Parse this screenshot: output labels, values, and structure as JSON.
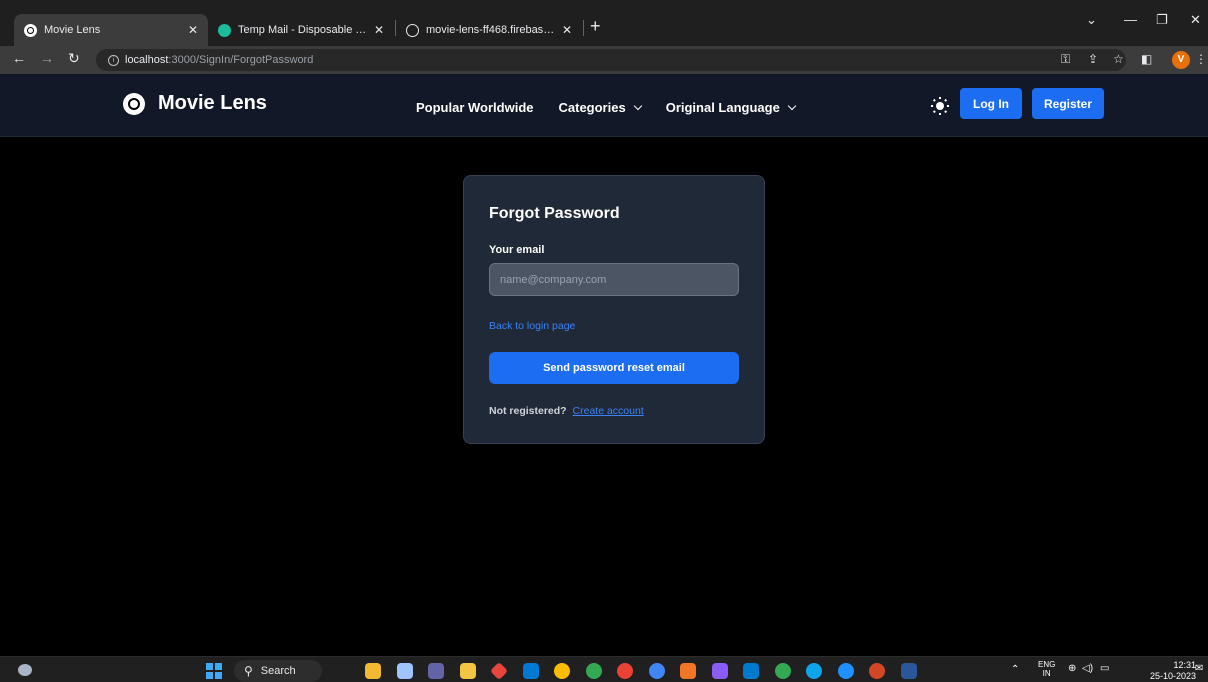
{
  "browser": {
    "tabs": [
      {
        "title": "Movie Lens",
        "favicon": "movielens-favicon"
      },
      {
        "title": "Temp Mail - Disposable Tempor",
        "favicon": "tempmail-favicon"
      },
      {
        "title": "movie-lens-ff468.firebaseapp.co",
        "favicon": "globe-icon"
      }
    ],
    "url_host": "localhost",
    "url_path": ":3000/SignIn/ForgotPassword",
    "profile_initial": "V"
  },
  "navbar": {
    "brand": "Movie Lens",
    "links": [
      "Popular Worldwide",
      "Categories",
      "Original Language"
    ],
    "login_label": "Log In",
    "register_label": "Register"
  },
  "form": {
    "title": "Forgot Password",
    "email_label": "Your email",
    "email_placeholder": "name@company.com",
    "email_value": "",
    "back_link": "Back to login page",
    "submit_label": "Send password reset email",
    "footer_prefix": "Not registered?",
    "footer_link": "Create account"
  },
  "taskbar": {
    "search_label": "Search",
    "language": "ENG",
    "region": "IN",
    "time": "12:31",
    "date": "25-10-2023"
  },
  "colors": {
    "accent": "#1d6df2",
    "link": "#3b82f6",
    "navbar_bg": "#111827",
    "card_bg": "#1f2937",
    "page_bg": "#000000"
  }
}
